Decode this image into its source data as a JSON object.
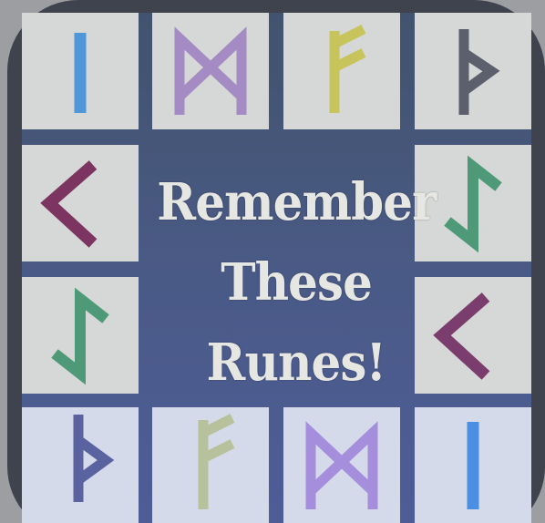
{
  "title": {
    "line1": "Remember",
    "line2": "These",
    "line3": "Runes!"
  },
  "colors": {
    "frame": "#3f434d",
    "board": "#4a5a86",
    "tile": "#d5d8d6",
    "title_text": "#e6e6e2"
  },
  "tiles": [
    {
      "rune": "isa-icon",
      "color": "#4f97d8"
    },
    {
      "rune": "mannaz-icon",
      "color": "#a48bc3"
    },
    {
      "rune": "ansuz-icon",
      "color": "#c7c45c"
    },
    {
      "rune": "thurisaz-icon",
      "color": "#5c5f6c"
    },
    {
      "rune": "kaunan-icon",
      "color": "#7b3560"
    },
    {
      "rune": "eihwaz-icon",
      "color": "#4e9a78"
    },
    {
      "rune": "eihwaz-icon",
      "color": "#4e9a78"
    },
    {
      "rune": "kaunan-icon",
      "color": "#7b3c6e"
    },
    {
      "rune": "thurisaz-icon",
      "color": "#5a63a0"
    },
    {
      "rune": "ansuz-icon",
      "color": "#b7c29c"
    },
    {
      "rune": "mannaz-icon",
      "color": "#a58edb"
    },
    {
      "rune": "isa-icon",
      "color": "#4b8fe3"
    }
  ]
}
